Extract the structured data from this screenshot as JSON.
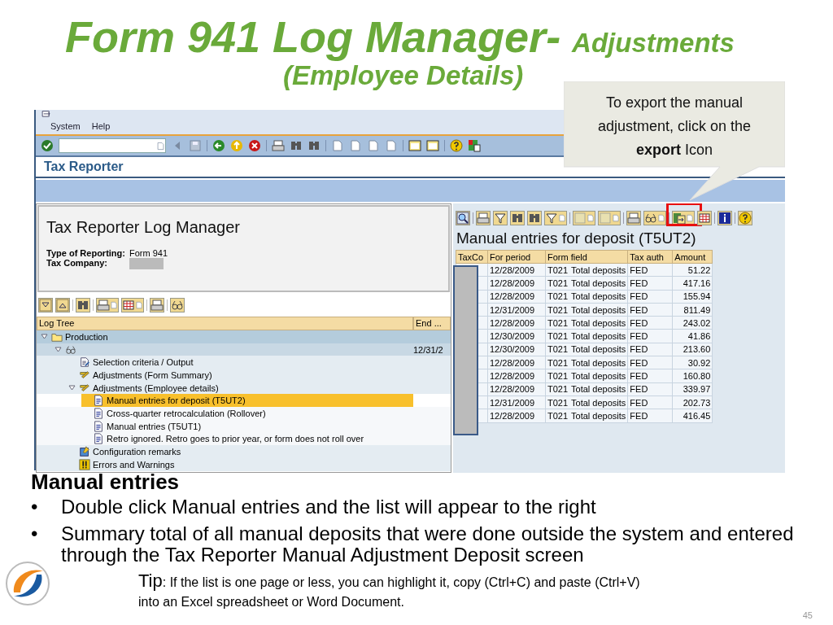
{
  "slide": {
    "title": "Form 941 Log Manager-",
    "title_suffix": "Adjustments",
    "subtitle": "(Employee Details)",
    "page_number": "45"
  },
  "sap": {
    "menu": [
      "System",
      "Help"
    ],
    "screen_title": "Tax Reporter",
    "log_panel": {
      "title": "Tax Reporter Log Manager",
      "fields": [
        {
          "label": "Type of Reporting:",
          "value": "Form 941",
          "redacted": false
        },
        {
          "label": "Tax Company:",
          "redacted": true
        }
      ],
      "tree_columns": [
        "Log Tree",
        "End ..."
      ],
      "tree": [
        {
          "label": "Production",
          "kind": "folder",
          "selected": false,
          "expanded": true,
          "children": [
            {
              "kind": "glasses",
              "end": "12/31/2",
              "selected": false,
              "expanded": true,
              "children": [
                {
                  "label": "Selection criteria / Output",
                  "kind": "edit-doc",
                  "selected": false
                },
                {
                  "label": "Adjustments (Form Summary)",
                  "kind": "pencils",
                  "selected": false
                },
                {
                  "label": "Adjustments (Employee details)",
                  "kind": "pencils",
                  "selected": false,
                  "expanded": true,
                  "children": [
                    {
                      "label": "Manual entries for deposit (T5UT2)",
                      "kind": "document",
                      "selected": true
                    },
                    {
                      "label": "Cross-quarter retrocalculation (Rollover)",
                      "kind": "document",
                      "selected": false
                    },
                    {
                      "label": "Manual entries (T5UT1)",
                      "kind": "document",
                      "selected": false
                    },
                    {
                      "label": "Retro ignored. Retro goes to prior year, or form does not roll over",
                      "kind": "document",
                      "selected": false
                    }
                  ]
                },
                {
                  "label": "Configuration remarks",
                  "kind": "config",
                  "selected": false
                },
                {
                  "label": "Errors and Warnings",
                  "kind": "warning",
                  "selected": false
                }
              ]
            }
          ]
        }
      ]
    },
    "entries_panel": {
      "title": "Manual entries for deposit (T5UT2)",
      "columns": [
        "TaxCo",
        "For period",
        "Form field",
        "Tax auth",
        "Amount"
      ],
      "rows": [
        {
          "period": "12/28/2009",
          "field": "T021",
          "field_text": "Total deposits",
          "tax_auth": "FED",
          "amount": "51.22"
        },
        {
          "period": "12/28/2009",
          "field": "T021",
          "field_text": "Total deposits",
          "tax_auth": "FED",
          "amount": "417.16"
        },
        {
          "period": "12/28/2009",
          "field": "T021",
          "field_text": "Total deposits",
          "tax_auth": "FED",
          "amount": "155.94"
        },
        {
          "period": "12/31/2009",
          "field": "T021",
          "field_text": "Total deposits",
          "tax_auth": "FED",
          "amount": "811.49"
        },
        {
          "period": "12/28/2009",
          "field": "T021",
          "field_text": "Total deposits",
          "tax_auth": "FED",
          "amount": "243.02"
        },
        {
          "period": "12/30/2009",
          "field": "T021",
          "field_text": "Total deposits",
          "tax_auth": "FED",
          "amount": "41.86"
        },
        {
          "period": "12/30/2009",
          "field": "T021",
          "field_text": "Total deposits",
          "tax_auth": "FED",
          "amount": "213.60"
        },
        {
          "period": "12/28/2009",
          "field": "T021",
          "field_text": "Total deposits",
          "tax_auth": "FED",
          "amount": "30.92"
        },
        {
          "period": "12/28/2009",
          "field": "T021",
          "field_text": "Total deposits",
          "tax_auth": "FED",
          "amount": "160.80"
        },
        {
          "period": "12/28/2009",
          "field": "T021",
          "field_text": "Total deposits",
          "tax_auth": "FED",
          "amount": "339.97"
        },
        {
          "period": "12/31/2009",
          "field": "T021",
          "field_text": "Total deposits",
          "tax_auth": "FED",
          "amount": "202.73"
        },
        {
          "period": "12/28/2009",
          "field": "T021",
          "field_text": "Total deposits",
          "tax_auth": "FED",
          "amount": "416.45"
        }
      ]
    }
  },
  "callout": {
    "text": "To export the manual adjustment, click on the **export** Icon"
  },
  "notes": {
    "heading": "Manual entries",
    "bullets": [
      {
        "marker": "•",
        "text": "Double click Manual entries and the list will appear to the right"
      },
      {
        "marker": "•",
        "text": "Summary total of all manual deposits that were done outside the system and entered through the Tax Reporter Manual Adjustment Deposit screen"
      }
    ],
    "tip_label": "Tip",
    "tip_text": ":  If the list is one page or less, you can highlight it, copy (Ctrl+C) and paste (Ctrl+V) into an Excel spreadsheet or Word Document."
  }
}
